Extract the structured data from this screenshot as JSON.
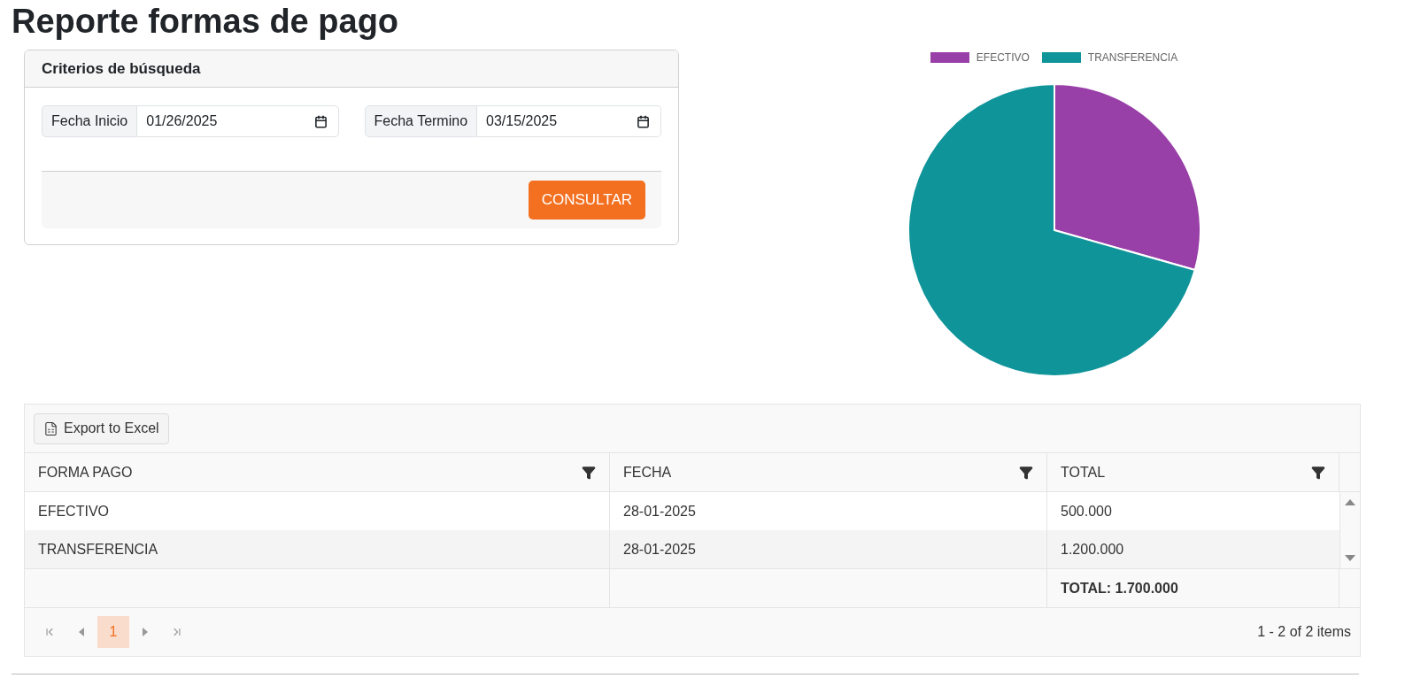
{
  "page_title": "Reporte formas de pago",
  "search_card": {
    "title": "Criterios de búsqueda",
    "fields": [
      {
        "label": "Fecha Inicio",
        "value": "01/26/2025"
      },
      {
        "label": "Fecha Termino",
        "value": "03/15/2025"
      }
    ],
    "button": "CONSULTAR"
  },
  "chart_data": {
    "type": "pie",
    "categories": [
      "EFECTIVO",
      "TRANSFERENCIA"
    ],
    "legend": "top",
    "values": [
      29.4,
      70.6
    ],
    "colors": [
      "#993fa8",
      "#0f949a"
    ]
  },
  "grid": {
    "toolbar_button": "Export to Excel",
    "columns": [
      "FORMA PAGO",
      "FECHA",
      "TOTAL"
    ],
    "rows": [
      [
        "EFECTIVO",
        "28-01-2025",
        "500.000"
      ],
      [
        "TRANSFERENCIA",
        "28-01-2025",
        "1.200.000"
      ]
    ],
    "footer": {
      "total": "TOTAL: 1.700.000"
    },
    "pages": [
      {
        "label": "1",
        "selected": true
      }
    ],
    "pager_info": "1 - 2 of 2 items"
  }
}
